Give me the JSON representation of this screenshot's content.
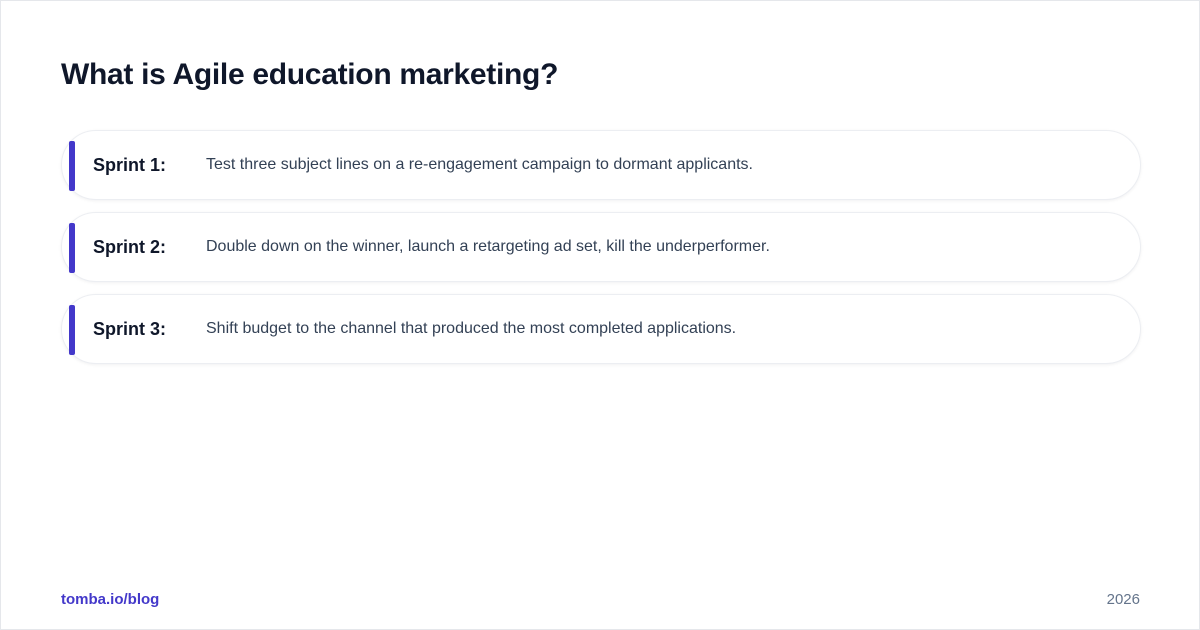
{
  "title": "What is Agile education marketing?",
  "sprints": [
    {
      "label": "Sprint 1:",
      "text": "Test three subject lines on a re-engagement campaign to dormant applicants."
    },
    {
      "label": "Sprint 2:",
      "text": "Double down on the winner, launch a retargeting ad set, kill the underperformer."
    },
    {
      "label": "Sprint 3:",
      "text": "Shift budget to the channel that produced the most completed applications."
    }
  ],
  "footer": {
    "link": "tomba.io/blog",
    "year": "2026"
  },
  "colors": {
    "accent": "#4338ca",
    "title": "#0f172a",
    "body_text": "#334155",
    "muted": "#64748b"
  }
}
